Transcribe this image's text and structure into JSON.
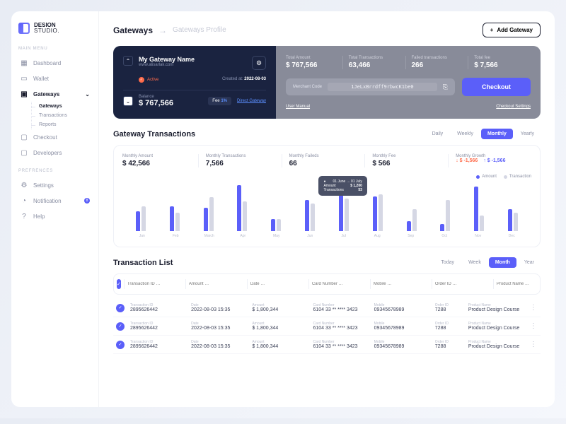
{
  "brand": {
    "name": "DESION",
    "sub": "STUDIO."
  },
  "sidebar": {
    "section1": "Main Menu",
    "items": [
      {
        "label": "Dashboard"
      },
      {
        "label": "Wallet"
      },
      {
        "label": "Gateways"
      },
      {
        "label": "Checkout"
      },
      {
        "label": "Developers"
      }
    ],
    "sub": [
      {
        "label": "Gateways"
      },
      {
        "label": "Transactions"
      },
      {
        "label": "Reports"
      }
    ],
    "section2": "Prefrences",
    "prefs": [
      {
        "label": "Settings"
      },
      {
        "label": "Notification",
        "badge": "8"
      },
      {
        "label": "Help"
      }
    ]
  },
  "breadcrumb": {
    "main": "Gateways",
    "sub": "Gateways Profile"
  },
  "add_btn": "Add Gateway",
  "gateway": {
    "name": "My Gateway Name",
    "url": "www.alisarlak.com",
    "status": "Active",
    "created_lbl": "Created at:",
    "created": "2022-08-03",
    "balance_lbl": "Balance",
    "balance": "$ 767,566",
    "fee_lbl": "Fee",
    "fee_val": "1%",
    "direct": "Direct Gateway"
  },
  "stats": [
    {
      "label": "Total Amount",
      "value": "$ 767,566"
    },
    {
      "label": "Total Transactions",
      "value": "63,466"
    },
    {
      "label": "Failed transactions",
      "value": "266"
    },
    {
      "label": "Total fee",
      "value": "$ 7,566"
    }
  ],
  "merchant": {
    "label": "Merchant Code",
    "code": "1JeLxBrrdff9rbwcK1be0"
  },
  "checkout": "Checkout",
  "links": {
    "manual": "User Manual",
    "settings": "Checkout Settings"
  },
  "gt": {
    "title": "Gateway Transactions",
    "tabs": [
      "Daily",
      "Weekly",
      "Monthly",
      "Yearly"
    ],
    "metrics": [
      {
        "label": "Monthly Amount",
        "value": "$ 42,566"
      },
      {
        "label": "Monthly Transactions",
        "value": "7,566"
      },
      {
        "label": "Monthly Faileds",
        "value": "66"
      },
      {
        "label": "Monthly Fee",
        "value": "$ 566"
      }
    ],
    "growth_label": "Monthly Growth",
    "growth_down": "$ -1,566",
    "growth_up": "$ -1,566",
    "legend": {
      "a": "Amount",
      "b": "Transaction"
    }
  },
  "chart_data": {
    "type": "bar",
    "categories": [
      "Jan",
      "Feb",
      "March",
      "Apr",
      "May",
      "Jun",
      "Jul",
      "Aug",
      "Sep",
      "Oct",
      "Nov",
      "Dec"
    ],
    "series": [
      {
        "name": "Amount",
        "values": [
          800,
          1000,
          950,
          1850,
          500,
          1250,
          1500,
          1400,
          400,
          300,
          1800,
          900
        ]
      },
      {
        "name": "Transaction",
        "values": [
          40,
          30,
          55,
          48,
          20,
          45,
          53,
          60,
          35,
          50,
          25,
          30
        ]
      }
    ],
    "ylim": [
      0,
      2000
    ],
    "tooltip": {
      "range": "01 June → 01 July",
      "amount": "$ 1,200",
      "tx": "53"
    }
  },
  "tl": {
    "title": "Transaction List",
    "tabs": [
      "Today",
      "Week",
      "Month",
      "Year"
    ],
    "filters": [
      "Transaction ID …",
      "Amount …",
      "Date …",
      "Card Number …",
      "Mobile …",
      "Order ID …",
      "Product Name …"
    ],
    "cols": [
      "Transaction ID",
      "Date",
      "Amount",
      "Card Number",
      "Mobile",
      "Order ID",
      "Product Name"
    ],
    "rows": [
      {
        "id": "2895626442",
        "date": "2022-08-03  15:35",
        "amount": "$  1,800,344",
        "card": "6104 33 ** **** 3423",
        "mobile": "09345678989",
        "order": "7288",
        "product": "Product Design Course"
      },
      {
        "id": "2895626442",
        "date": "2022-08-03  15:35",
        "amount": "$  1,800,344",
        "card": "6104 33 ** **** 3423",
        "mobile": "09345678989",
        "order": "7288",
        "product": "Product Design Course"
      },
      {
        "id": "2895626442",
        "date": "2022-08-03  15:35",
        "amount": "$  1,800,344",
        "card": "6104 33 ** **** 3423",
        "mobile": "09345678989",
        "order": "7288",
        "product": "Product Design Course"
      }
    ]
  }
}
